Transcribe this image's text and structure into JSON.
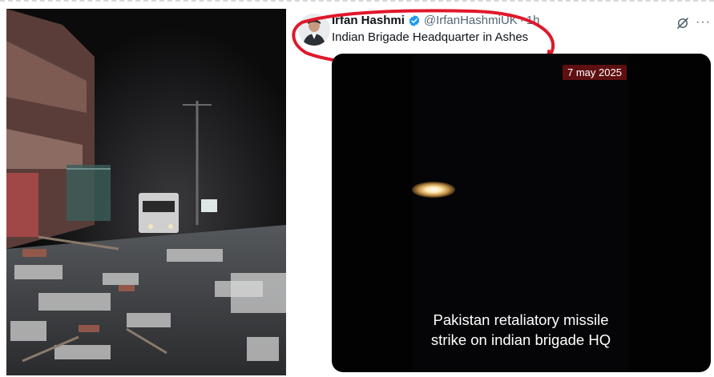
{
  "tweet": {
    "author_name": "Irfan Hashmi",
    "handle": "@IrfanHashmiUK",
    "separator": "·",
    "time": "1h",
    "text": "Indian Brigade Headquarter in Ashes",
    "more_icon": "···",
    "icons": {
      "verified": "verified-badge-icon",
      "grok": "grok-icon",
      "more": "more-icon"
    },
    "colors": {
      "verified": "#1d9bf0",
      "annotation": "#e0182b"
    }
  },
  "video": {
    "date_overlay": "7 may 2025",
    "caption_line1": "Pakistan retaliatory missile",
    "caption_line2": "strike on indian brigade HQ"
  }
}
